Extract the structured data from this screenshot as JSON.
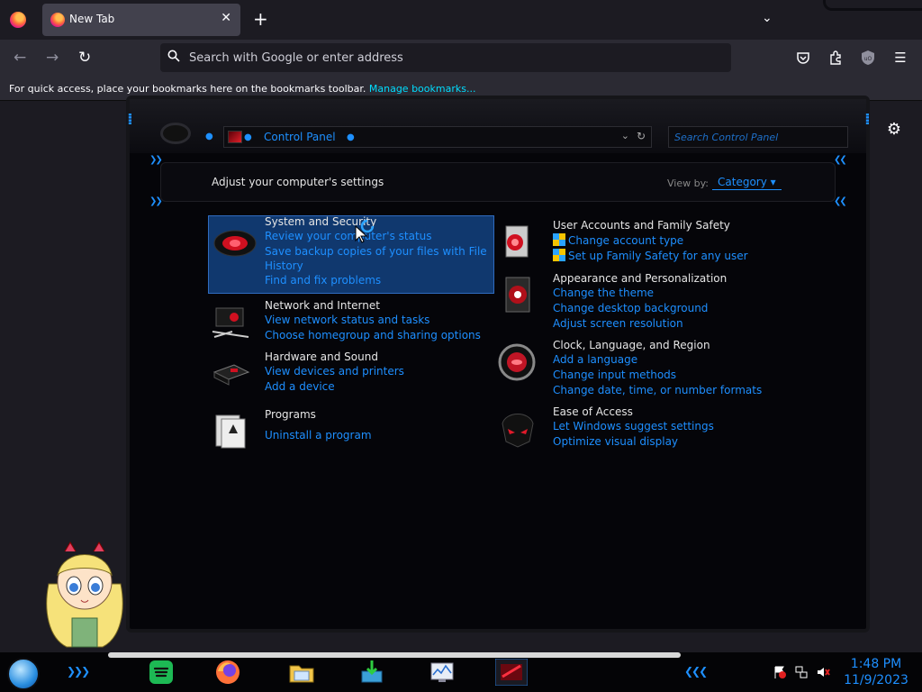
{
  "browser": {
    "tab_title": "New Tab",
    "url_placeholder": "Search with Google or enter address",
    "bookmarks_message": "For quick access, place your bookmarks here on the bookmarks toolbar.",
    "bookmarks_link": "Manage bookmarks..."
  },
  "control_panel": {
    "address": "Control Panel",
    "search_placeholder": "Search Control Panel",
    "heading": "Adjust your computer's settings",
    "view_by_label": "View by:",
    "view_by_value": "Category",
    "categories": [
      {
        "name": "System and Security",
        "links": [
          "Review your computer's status",
          "Save backup copies of your files with File",
          "History",
          "Find and fix problems"
        ]
      },
      {
        "name": "Network and Internet",
        "links": [
          "View network status and tasks",
          "Choose homegroup and sharing options"
        ]
      },
      {
        "name": "Hardware and Sound",
        "links": [
          "View devices and printers",
          "Add a device"
        ]
      },
      {
        "name": "Programs",
        "links": [
          "Uninstall a program"
        ]
      },
      {
        "name": "User Accounts and Family Safety",
        "links": [
          "Change account type",
          "Set up Family Safety for any user"
        ]
      },
      {
        "name": "Appearance and Personalization",
        "links": [
          "Change the theme",
          "Change desktop background",
          "Adjust screen resolution"
        ]
      },
      {
        "name": "Clock, Language, and Region",
        "links": [
          "Add a language",
          "Change input methods",
          "Change date, time, or number formats"
        ]
      },
      {
        "name": "Ease of Access",
        "links": [
          "Let Windows suggest settings",
          "Optimize visual display"
        ]
      }
    ]
  },
  "taskbar": {
    "time": "1:48 PM",
    "date": "11/9/2023"
  }
}
